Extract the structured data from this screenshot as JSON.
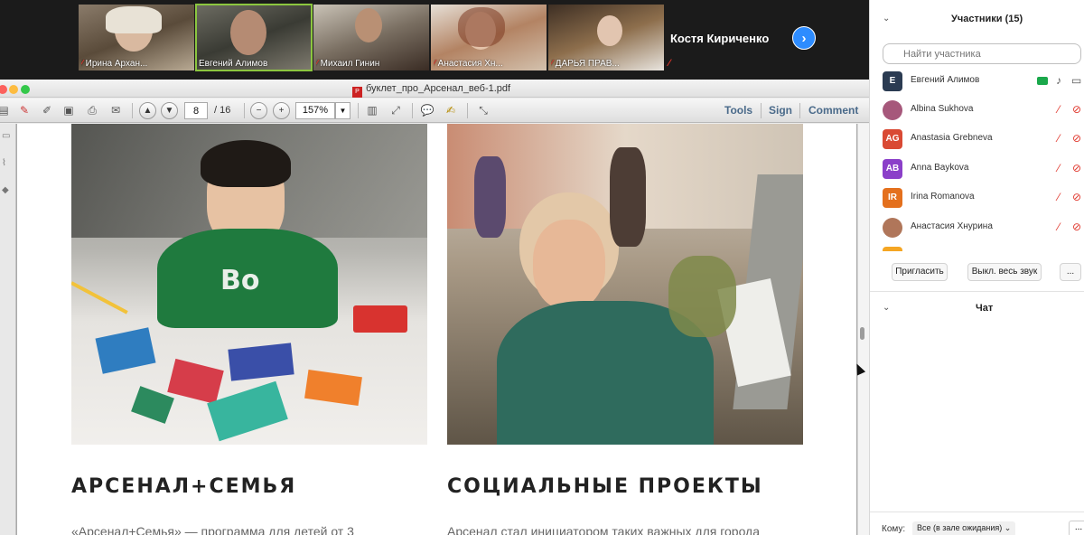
{
  "video_strip": {
    "tiles": [
      {
        "name": "Ирина Архан..."
      },
      {
        "name": "Евгений Алимов"
      },
      {
        "name": "Михаил Гинин"
      },
      {
        "name": "Анастасия Хн..."
      },
      {
        "name": "ДАРЬЯ ПРАВ..."
      }
    ],
    "featured_name": "Костя Кириченко"
  },
  "pdf": {
    "title": "буклет_про_Арсенал_веб-1.pdf",
    "current_page": "8",
    "total_pages": "/ 16",
    "zoom": "157%",
    "tools_label": "Tools",
    "sign_label": "Sign",
    "comment_label": "Comment",
    "page": {
      "left_heading": "АРСЕНАЛ+СЕМЬЯ",
      "right_heading": "СОЦИАЛЬНЫЕ ПРОЕКТЫ",
      "left_text": "«Арсенал+Семья» — программа для детей от 3",
      "right_text": "Арсенал стал инициатором таких важных для города"
    }
  },
  "participants": {
    "title": "Участники (15)",
    "search_placeholder": "Найти участника",
    "list": [
      {
        "initials": "E",
        "name": "Евгений Алимов",
        "color": "#2b3b52",
        "host": true
      },
      {
        "initials": "",
        "name": "Albina Sukhova",
        "color": "#a6587b",
        "host": false
      },
      {
        "initials": "AG",
        "name": "Anastasia Grebneva",
        "color": "#d94a34",
        "host": false
      },
      {
        "initials": "AB",
        "name": "Anna Baykova",
        "color": "#8b3fc9",
        "host": false
      },
      {
        "initials": "IR",
        "name": "Irina Romanova",
        "color": "#e4701d",
        "host": false
      },
      {
        "initials": "",
        "name": "Анастасия Хнурина",
        "color": "#b0765a",
        "host": false
      }
    ],
    "invite_label": "Пригласить",
    "mute_all_label": "Выкл. весь звук",
    "more_label": "..."
  },
  "chat": {
    "title": "Чат",
    "to_label": "Кому:",
    "recipient": "Все (в зале ожидания)",
    "more_label": "..."
  }
}
